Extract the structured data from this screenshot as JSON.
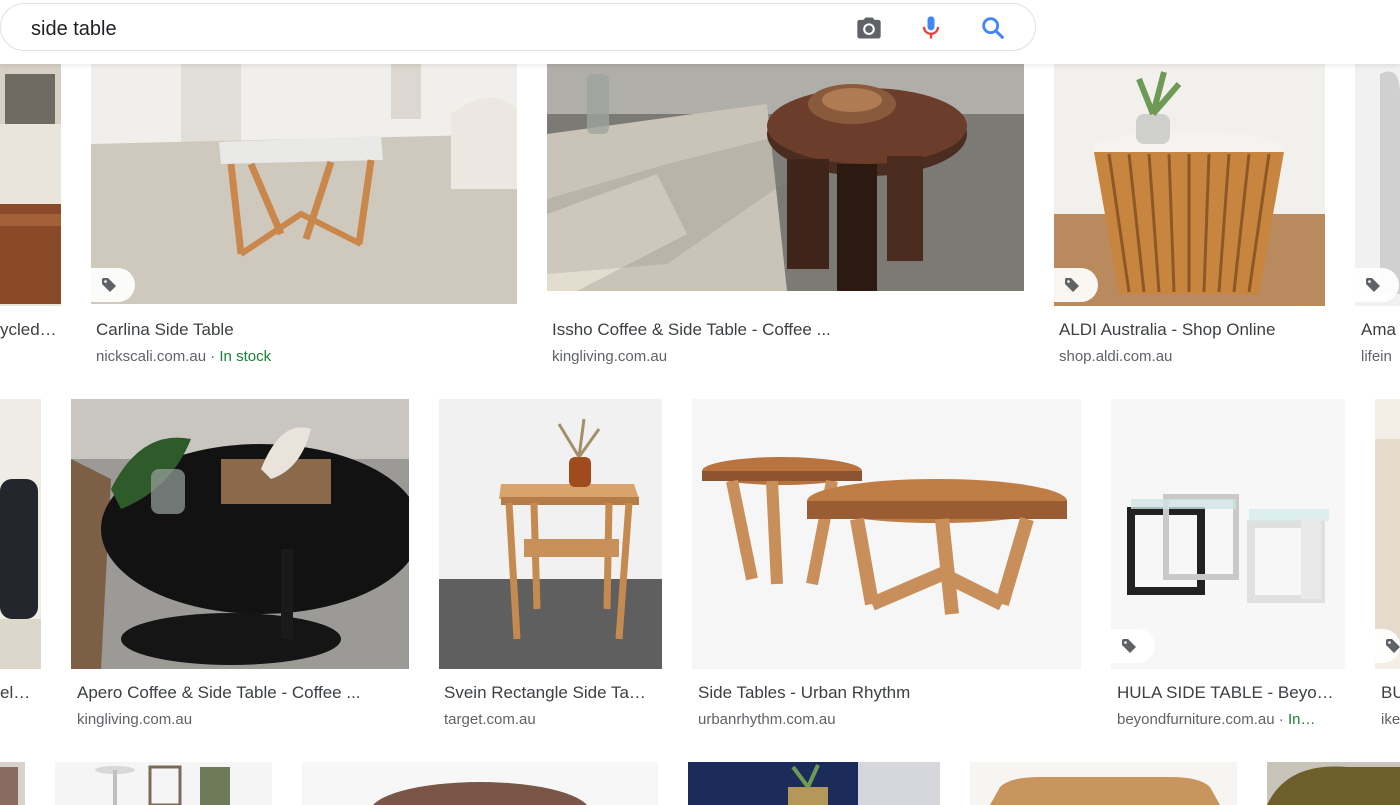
{
  "search": {
    "query": "side table",
    "icons": [
      "camera-icon",
      "microphone-icon",
      "search-icon"
    ],
    "colors": {
      "mic_blue": "#4285f4",
      "mic_red": "#ea4335",
      "search_blue": "#4285f4",
      "camera": "#5f6368"
    }
  },
  "results": {
    "row1": [
      {
        "title": "ycled…",
        "source": ""
      },
      {
        "title": "Carlina Side Table",
        "source": "nickscali.com.au",
        "stock": "In stock"
      },
      {
        "title": "Issho Coffee & Side Table - Coffee ...",
        "source": "kingliving.com.au"
      },
      {
        "title": "ALDI Australia - Shop Online",
        "source": "shop.aldi.com.au"
      },
      {
        "title": "Ama",
        "source": "lifein"
      }
    ],
    "row2": [
      {
        "title": "el…",
        "source": ""
      },
      {
        "title": "Apero Coffee & Side Table - Coffee ...",
        "source": "kingliving.com.au"
      },
      {
        "title": "Svein Rectangle Side Ta…",
        "source": "target.com.au"
      },
      {
        "title": "Side Tables - Urban Rhythm",
        "source": "urbanrhythm.com.au"
      },
      {
        "title": "HULA SIDE TABLE - Beyo…",
        "source": "beyondfurniture.com.au",
        "stock": "In…"
      },
      {
        "title": "BU",
        "source": "ike"
      }
    ]
  },
  "ui": {
    "stock_separator": " · ",
    "stock_color": "#188038",
    "product_tag_icon": "tag-icon"
  }
}
